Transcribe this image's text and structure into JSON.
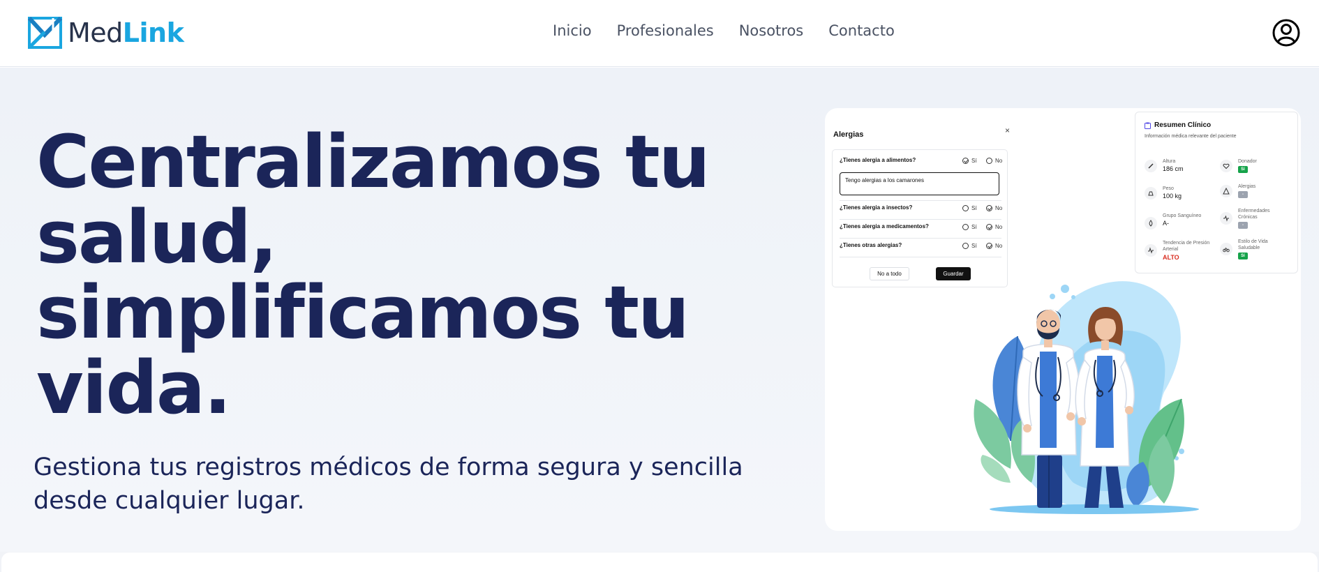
{
  "brand": {
    "name_part1": "Med",
    "name_part2": "Link",
    "colors": {
      "dark": "#27324a",
      "accent": "#1aa6e0",
      "navy": "#1b2559"
    }
  },
  "nav": {
    "items": [
      {
        "label": "Inicio"
      },
      {
        "label": "Profesionales"
      },
      {
        "label": "Nosotros"
      },
      {
        "label": "Contacto"
      }
    ],
    "user_icon": "user-circle-icon"
  },
  "hero": {
    "headline_lines": [
      "Centralizamos tu",
      "salud,",
      "simplificamos tu",
      "vida."
    ],
    "subtitle_lines": [
      "Gestiona tus registros médicos de forma segura y sencilla",
      "desde cualquier lugar."
    ]
  },
  "allergies_form": {
    "title": "Alergias",
    "close": "×",
    "questions": [
      {
        "text": "¿Tienes alergia a alimentos?",
        "yes": "Sí",
        "no": "No",
        "selected": "yes"
      },
      {
        "text": "¿Tienes alergia a insectos?",
        "yes": "Sí",
        "no": "No",
        "selected": "no"
      },
      {
        "text": "¿Tienes alergia a medicamentos?",
        "yes": "Sí",
        "no": "No",
        "selected": "no"
      },
      {
        "text": "¿Tienes otras alergias?",
        "yes": "Sí",
        "no": "No",
        "selected": "no"
      }
    ],
    "food_detail_value": "Tengo alergias a los camarones",
    "btn_no_all": "No a todo",
    "btn_save": "Guardar"
  },
  "clinical_summary": {
    "title": "Resumen Clínico",
    "description": "Información médica relevante del paciente",
    "height": {
      "label": "Altura",
      "value": "186 cm",
      "icon": "ruler-icon"
    },
    "weight": {
      "label": "Peso",
      "value": "100 kg",
      "icon": "scale-icon"
    },
    "blood": {
      "label": "Grupo Sanguíneo",
      "value": "A-",
      "icon": "drop-icon"
    },
    "pressure": {
      "label": "Tendencia de Presión Arterial",
      "value": "ALTO",
      "icon": "pulse-icon"
    },
    "donor": {
      "label": "Donador",
      "badge": "Sí",
      "icon": "heart-icon"
    },
    "allergies": {
      "label": "Alergias",
      "badge": "-",
      "icon": "warning-icon"
    },
    "chronic": {
      "label": "Enfermedades Crónicas",
      "badge": "-",
      "icon": "activity-icon"
    },
    "lifestyle": {
      "label": "Estilo de Vida Saludable",
      "badge": "Sí",
      "icon": "bike-icon"
    }
  }
}
